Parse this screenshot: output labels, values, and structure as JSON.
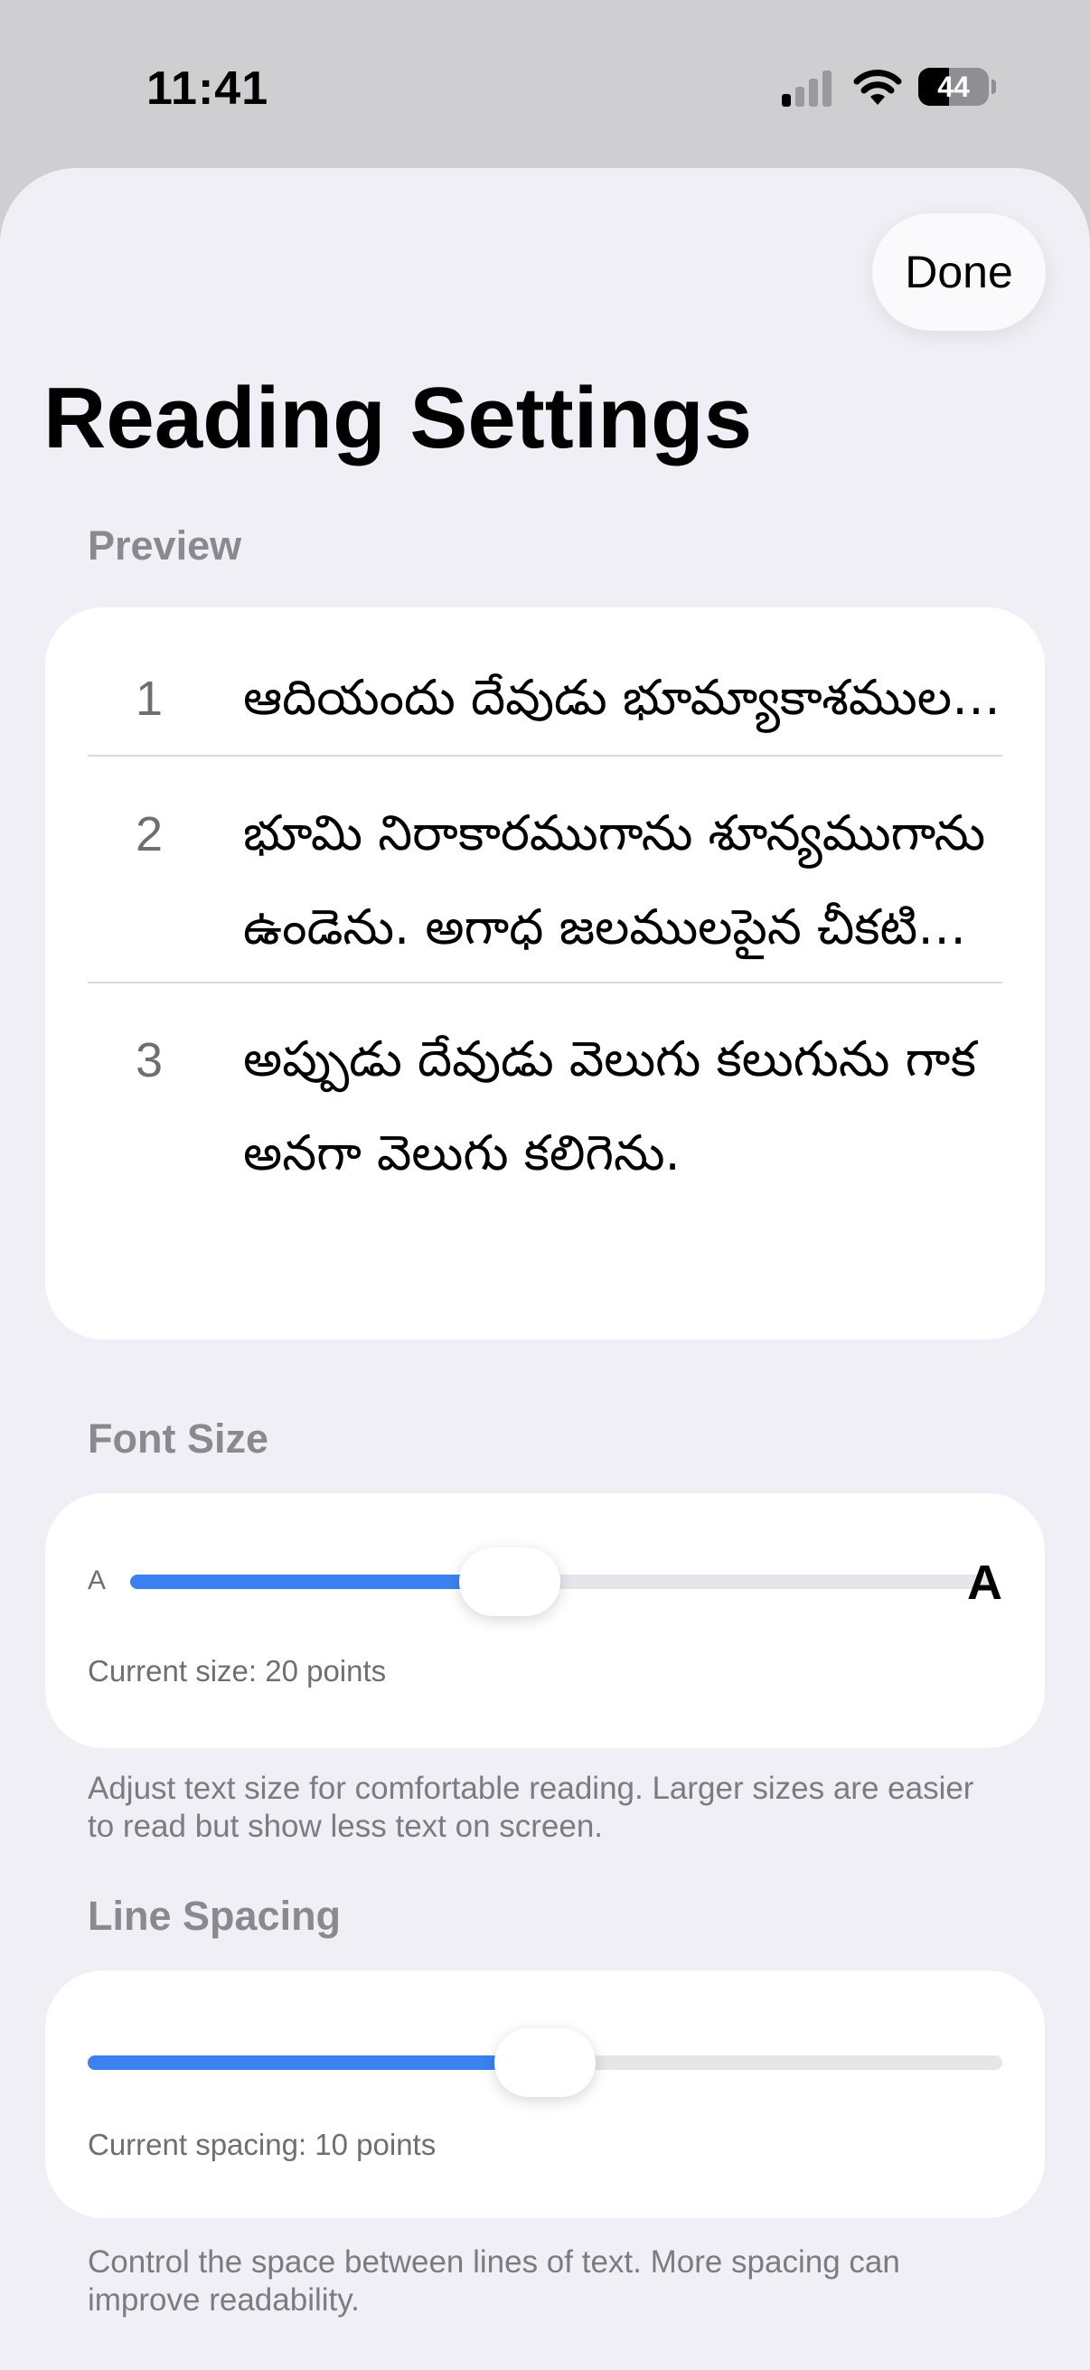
{
  "status_bar": {
    "time": "11:41",
    "signal_icon": "cellular-signal-icon",
    "wifi_icon": "wifi-icon",
    "battery_icon": "battery-icon",
    "battery_level": "44"
  },
  "sheet": {
    "done_label": "Done",
    "title": "Reading Settings"
  },
  "preview": {
    "header": "Preview",
    "verses": [
      {
        "number": "1",
        "text": "ఆదియందు దేవుడు భూమ్యాకాశములను సృజించెను."
      },
      {
        "number": "2",
        "text": "భూమి నిరాకారముగాను శూన్యముగాను ఉండెను. అగాధ జలములపైన చీకటి కమ్మియుండెను."
      },
      {
        "number": "3",
        "text": "అప్పుడు దేవుడు వెలుగు కలుగును గాక అనగా వెలుగు కలిగెను."
      }
    ]
  },
  "font_size": {
    "header": "Font Size",
    "small_label": "A",
    "large_label": "A",
    "slider_fraction": 0.44,
    "current_text": "Current size: 20 points",
    "footer": "Adjust text size for comfortable reading. Larger sizes are easier to read but show less text on screen."
  },
  "line_spacing": {
    "header": "Line Spacing",
    "slider_fraction": 0.5,
    "current_text": "Current spacing: 10 points",
    "footer": "Control the space between lines of text. More spacing can improve readability."
  },
  "colors": {
    "accent": "#3b82f0",
    "sheet_background": "#f0eff5",
    "card_background": "#ffffff",
    "secondary_text": "#8a8a8e"
  }
}
